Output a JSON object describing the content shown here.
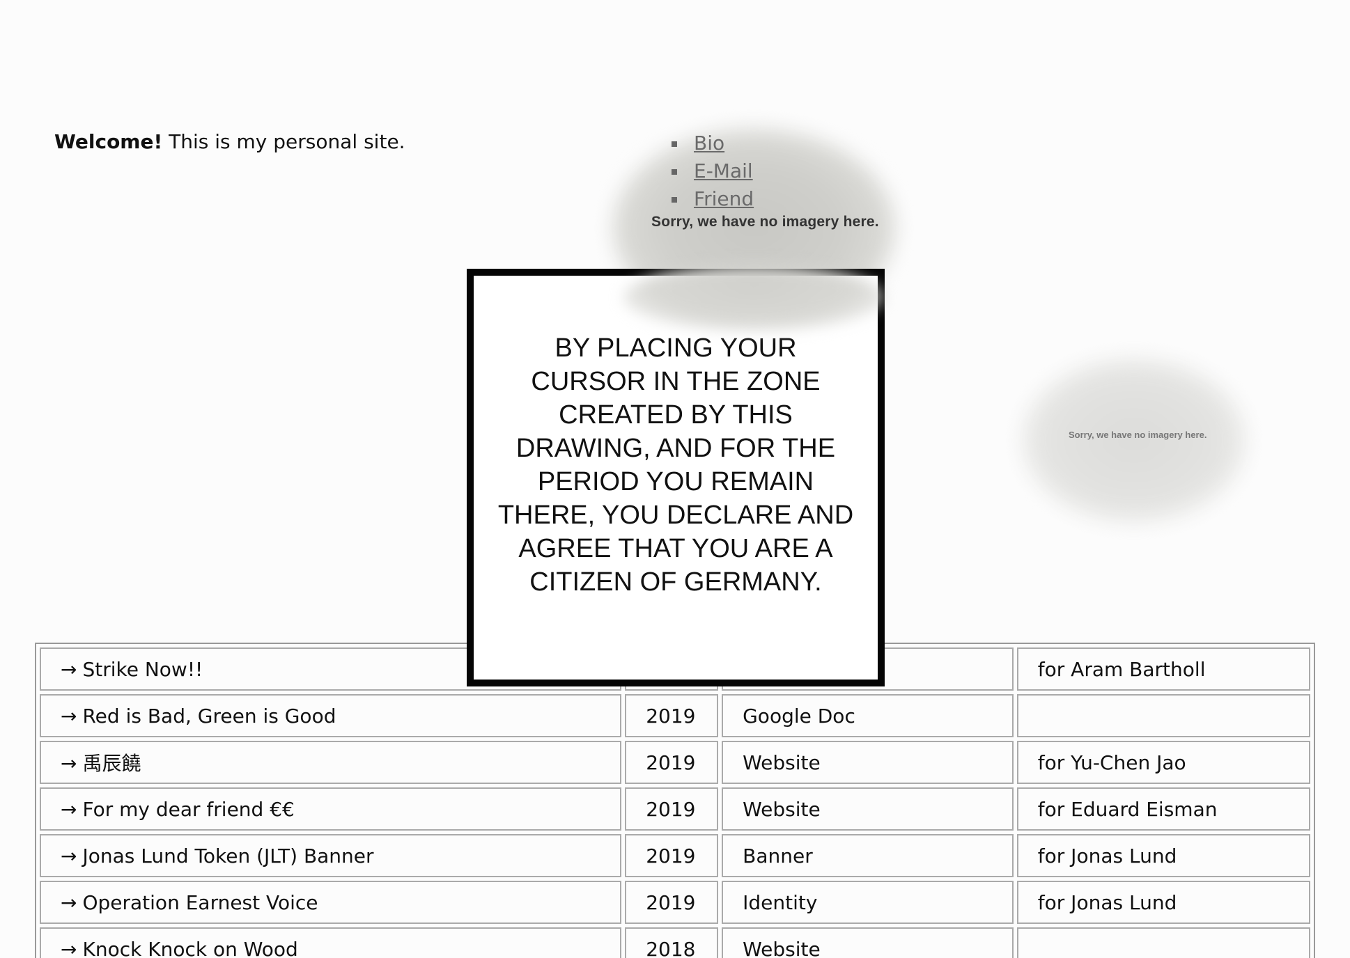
{
  "welcome": {
    "bold": "Welcome!",
    "text": " This is my personal site."
  },
  "nav": {
    "items": [
      {
        "label": "Bio"
      },
      {
        "label": "E-Mail"
      },
      {
        "label": "Friend"
      }
    ]
  },
  "map_placeholder": {
    "text": "Sorry, we have no imagery here."
  },
  "modal": {
    "text": "BY PLACING YOUR CURSOR IN THE ZONE CREATED BY THIS DRAWING, AND FOR THE PERIOD YOU REMAIN THERE, YOU DECLARE AND AGREE THAT YOU ARE A CITIZEN OF GERMANY."
  },
  "works": {
    "arrow": "→",
    "rows": [
      {
        "title": "Strike Now!!",
        "year": "",
        "type": "",
        "credit": "for Aram Bartholl"
      },
      {
        "title": "Red is Bad, Green is Good",
        "year": "2019",
        "type": "Google Doc",
        "credit": ""
      },
      {
        "title": "禹辰饒",
        "year": "2019",
        "type": "Website",
        "credit": "for Yu-Chen Jao"
      },
      {
        "title": "For my dear friend €€",
        "year": "2019",
        "type": "Website",
        "credit": "for Eduard Eisman"
      },
      {
        "title": "Jonas Lund Token (JLT) Banner",
        "year": "2019",
        "type": "Banner",
        "credit": "for Jonas Lund"
      },
      {
        "title": "Operation Earnest Voice",
        "year": "2019",
        "type": "Identity",
        "credit": "for Jonas Lund"
      },
      {
        "title": "Knock Knock on Wood",
        "year": "2018",
        "type": "Website",
        "credit": ""
      }
    ]
  }
}
